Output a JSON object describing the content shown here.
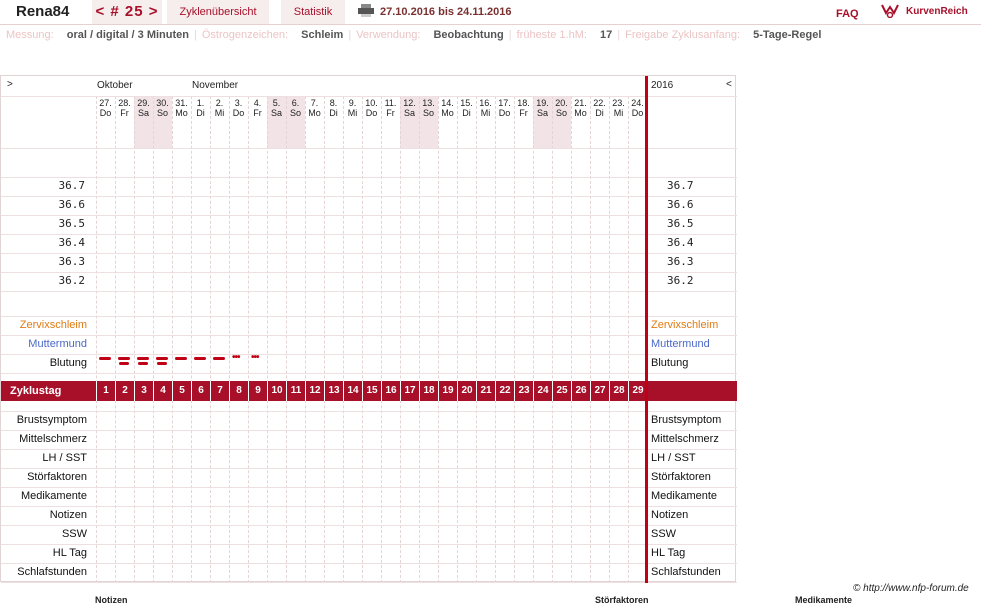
{
  "header": {
    "user": "Rena84",
    "cycle_nav": "< # 25 >",
    "tab_overview": "Zyklenübersicht",
    "tab_stats": "Statistik",
    "date_range": "27.10.2016 bis 24.11.2016",
    "faq": "FAQ",
    "logo": "KurvenReich"
  },
  "info": [
    {
      "label": "Messung:",
      "value": "oral / digital / 3 Minuten"
    },
    {
      "label": "Östrogenzeichen:",
      "value": "Schleim"
    },
    {
      "label": "Verwendung:",
      "value": "Beobachtung"
    },
    {
      "label": "früheste 1.hM:",
      "value": "17"
    },
    {
      "label": "Freigabe Zyklusanfang:",
      "value": "5-Tage-Regel"
    }
  ],
  "chart": {
    "nav_left": ">",
    "nav_right": "<",
    "month1": "Oktober",
    "month2": "November",
    "year": "2016",
    "days": [
      {
        "d": "27.",
        "w": "Do",
        "we": false
      },
      {
        "d": "28.",
        "w": "Fr",
        "we": false
      },
      {
        "d": "29.",
        "w": "Sa",
        "we": true
      },
      {
        "d": "30.",
        "w": "So",
        "we": true
      },
      {
        "d": "31.",
        "w": "Mo",
        "we": false
      },
      {
        "d": "1.",
        "w": "Di",
        "we": false
      },
      {
        "d": "2.",
        "w": "Mi",
        "we": false
      },
      {
        "d": "3.",
        "w": "Do",
        "we": false
      },
      {
        "d": "4.",
        "w": "Fr",
        "we": false
      },
      {
        "d": "5.",
        "w": "Sa",
        "we": true
      },
      {
        "d": "6.",
        "w": "So",
        "we": true
      },
      {
        "d": "7.",
        "w": "Mo",
        "we": false
      },
      {
        "d": "8.",
        "w": "Di",
        "we": false
      },
      {
        "d": "9.",
        "w": "Mi",
        "we": false
      },
      {
        "d": "10.",
        "w": "Do",
        "we": false
      },
      {
        "d": "11.",
        "w": "Fr",
        "we": false
      },
      {
        "d": "12.",
        "w": "Sa",
        "we": true
      },
      {
        "d": "13.",
        "w": "So",
        "we": true
      },
      {
        "d": "14.",
        "w": "Mo",
        "we": false
      },
      {
        "d": "15.",
        "w": "Di",
        "we": false
      },
      {
        "d": "16.",
        "w": "Mi",
        "we": false
      },
      {
        "d": "17.",
        "w": "Do",
        "we": false
      },
      {
        "d": "18.",
        "w": "Fr",
        "we": false
      },
      {
        "d": "19.",
        "w": "Sa",
        "we": true
      },
      {
        "d": "20.",
        "w": "So",
        "we": true
      },
      {
        "d": "21.",
        "w": "Mo",
        "we": false
      },
      {
        "d": "22.",
        "w": "Di",
        "we": false
      },
      {
        "d": "23.",
        "w": "Mi",
        "we": false
      },
      {
        "d": "24.",
        "w": "Do",
        "we": false
      }
    ],
    "temp_ticks": [
      "36.7",
      "36.6",
      "36.5",
      "36.4",
      "36.3",
      "36.2"
    ],
    "row_labels": {
      "cervical": "Zervixschleim",
      "cervix": "Muttermund",
      "bleeding": "Blutung",
      "cycleday": "Zyklustag"
    },
    "lower_rows": [
      "Brustsymptom",
      "Mittelschmerz",
      "LH / SST",
      "Störfaktoren",
      "Medikamente",
      "Notizen",
      "SSW",
      "HL Tag",
      "Schlafstunden"
    ],
    "bleeding": [
      "medium",
      "heavy",
      "heavy",
      "heavy",
      "medium",
      "medium",
      "medium",
      "spotting",
      "spotting"
    ],
    "colors": {
      "accent": "#a8102a",
      "cervical": "#e07a10",
      "cervix": "#4a68c8",
      "bleed": "#c00014"
    }
  },
  "footer": {
    "copyright": "© http://www.nfp-forum.de",
    "col1": "Notizen",
    "col2": "Störfaktoren",
    "col3": "Medikamente"
  }
}
